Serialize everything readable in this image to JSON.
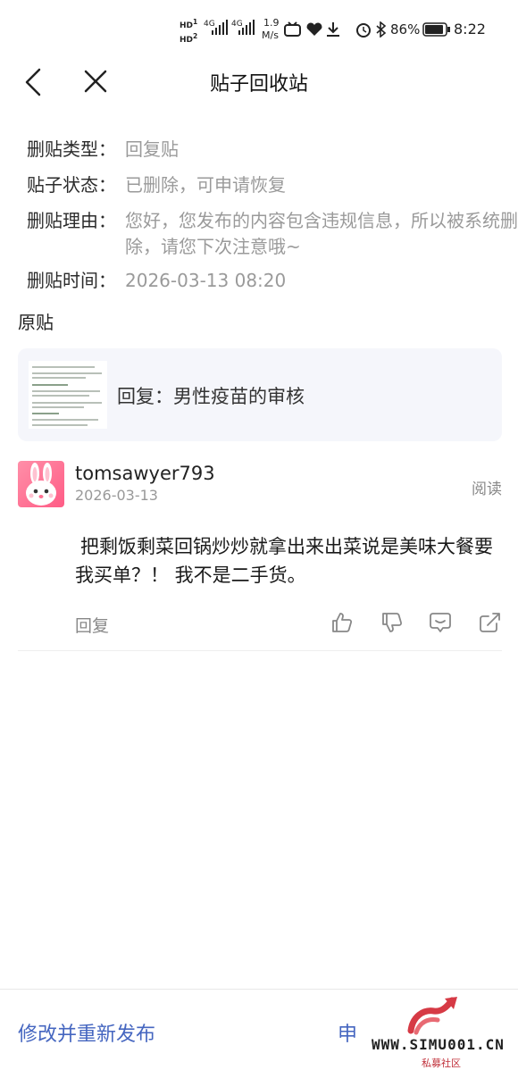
{
  "status_bar": {
    "hd_top": "HD",
    "hd_bottom": "HD",
    "hd_num_top": "1",
    "hd_num_bottom": "2",
    "net1": "4G",
    "net2": "4G",
    "speed_value": "1.9",
    "speed_unit": "M/s",
    "battery": "86%",
    "time": "8:22"
  },
  "header": {
    "title": "贴子回收站"
  },
  "info": [
    {
      "label": "删贴类型：",
      "value": "回复贴"
    },
    {
      "label": "贴子状态：",
      "value": "已删除，可申请恢复"
    },
    {
      "label": "删贴理由：",
      "value": "您好，您发布的内容包含违规信息，所以被系统删除，请您下次注意哦~"
    },
    {
      "label": "删贴时间：",
      "value": "2026-03-13 08:20"
    }
  ],
  "original": {
    "heading": "原贴",
    "card_title": "回复：男性疫苗的审核"
  },
  "post": {
    "username": "tomsawyer793",
    "date": "2026-03-13",
    "read_label": "阅读",
    "content": "把剩饭剩菜回锅炒炒就拿出来出菜说是美味大餐要我买单？！ 我不是二手货。",
    "reply_label": "回复"
  },
  "bottom": {
    "republish_label": "修改并重新发布",
    "apply_label": "申"
  },
  "watermark": {
    "text": "WWW.SIMU001.CN",
    "subtext": "私募社区"
  },
  "colors": {
    "link": "#4566c0",
    "muted": "#9a9a9a",
    "card_bg": "#f5f6fb"
  }
}
